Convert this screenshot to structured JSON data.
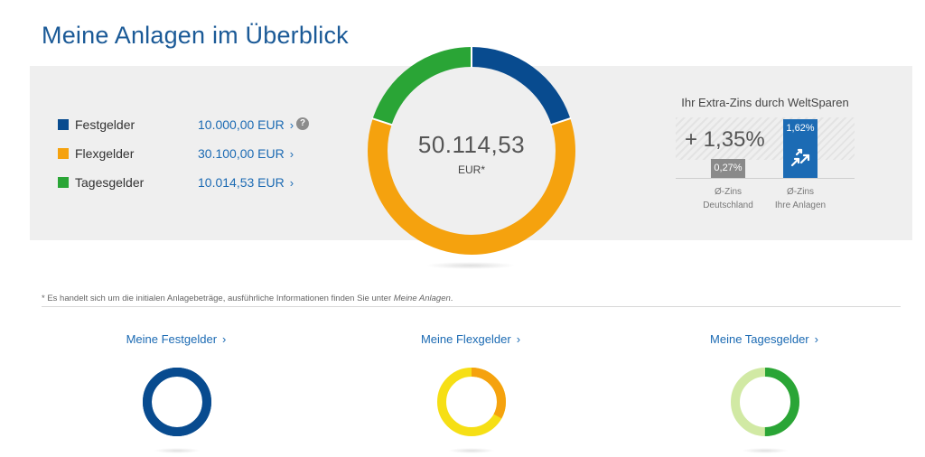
{
  "page": {
    "title": "Meine Anlagen im Überblick"
  },
  "colors": {
    "festgelder": "#084b8f",
    "flexgelder": "#f5a20e",
    "tagesgelder": "#2aa536",
    "accent_blue": "#1c6bb4"
  },
  "legend": {
    "items": [
      {
        "label": "Festgelder",
        "value": "10.000,00 EUR",
        "chevron": "›"
      },
      {
        "label": "Flexgelder",
        "value": "30.100,00 EUR",
        "chevron": "›"
      },
      {
        "label": "Tagesgelder",
        "value": "10.014,53 EUR",
        "chevron": "›"
      }
    ],
    "help_icon": "?"
  },
  "chart_data": {
    "type": "pie",
    "title": "",
    "center_value": "50.114,53",
    "center_unit": "EUR*",
    "categories": [
      "Festgelder",
      "Flexgelder",
      "Tagesgelder"
    ],
    "values": [
      10000.0,
      30100.0,
      10014.53
    ],
    "colors": [
      "#084b8f",
      "#f5a20e",
      "#2aa536"
    ],
    "style": "donut",
    "start": "top",
    "direction": "clockwise"
  },
  "extra_interest": {
    "title": "Ihr Extra-Zins durch WeltSparen",
    "value": "+ 1,35%",
    "bars": [
      {
        "value_label": "0,27%",
        "caption_line1": "Ø-Zins",
        "caption_line2": "Deutschland",
        "color": "#8a8a8a"
      },
      {
        "value_label": "1,62%",
        "caption_line1": "Ø-Zins",
        "caption_line2": "Ihre Anlagen",
        "color": "#1c6bb4",
        "icon": "arrows-icon"
      }
    ]
  },
  "footnote": {
    "text": "* Es handelt sich um die initialen Anlagebeträge, ausführliche Informationen finden Sie unter ",
    "emphasis": "Meine Anlagen",
    "end": "."
  },
  "sub_sections": [
    {
      "label": "Meine Festgelder",
      "chevron": "›",
      "ring_fraction": 1.0,
      "ring_color": "#084b8f",
      "ring_bg": "#084b8f"
    },
    {
      "label": "Meine Flexgelder",
      "chevron": "›",
      "ring_fraction": 0.33,
      "ring_color": "#f5a20e",
      "ring_bg": "#f6df15"
    },
    {
      "label": "Meine Tagesgelder",
      "chevron": "›",
      "ring_fraction": 0.5,
      "ring_color": "#2aa536",
      "ring_bg": "#d1e9a4"
    }
  ]
}
